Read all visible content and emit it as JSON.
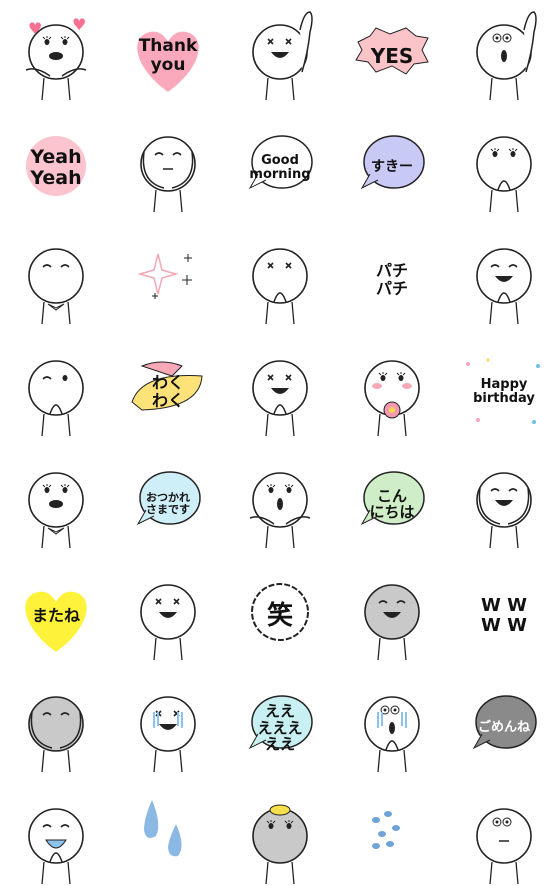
{
  "stickers": [
    {
      "kind": "face",
      "eyes": "lash",
      "mouth": "kiss",
      "extra": "hearts",
      "arms": "out"
    },
    {
      "kind": "bubble",
      "shape": "heart",
      "fill": "#f9a9bb",
      "text": "Thank\nyou",
      "size": 17
    },
    {
      "kind": "face",
      "eyes": "x",
      "mouth": "smile",
      "arms": "wave"
    },
    {
      "kind": "bubble",
      "shape": "burst",
      "fill": "#fbc4c9",
      "text": "YES",
      "size": 20
    },
    {
      "kind": "face",
      "eyes": "round",
      "mouth": "o",
      "arms": "wave"
    },
    {
      "kind": "bubble",
      "shape": "burst2",
      "fill": "#fbc4cf",
      "text": "Yeah\nYeah",
      "size": 19
    },
    {
      "kind": "face",
      "eyes": "closed",
      "mouth": "line",
      "arms": "cheeks"
    },
    {
      "kind": "bubble",
      "shape": "speech",
      "fill": "#ffffff",
      "text": "Good\nmorning",
      "size": 13
    },
    {
      "kind": "bubble",
      "shape": "speech",
      "fill": "#c9c9f5",
      "text": "すきー",
      "size": 14
    },
    {
      "kind": "face",
      "eyes": "lash",
      "mouth": "none",
      "arms": "mouth"
    },
    {
      "kind": "face",
      "eyes": "closed",
      "mouth": "none",
      "arms": "bow"
    },
    {
      "kind": "icon",
      "icon": "sparkles-icon",
      "accent": "#f3a6b3"
    },
    {
      "kind": "face",
      "eyes": "x",
      "mouth": "none",
      "arms": "clap"
    },
    {
      "kind": "bubble",
      "shape": "none",
      "fill": "#ffffff",
      "text": "パチ\nパチ",
      "size": 16
    },
    {
      "kind": "face",
      "eyes": "closed",
      "mouth": "smile",
      "arms": "clap2"
    },
    {
      "kind": "face",
      "eyes": "wink",
      "mouth": "none",
      "arms": "mouth"
    },
    {
      "kind": "bubble",
      "shape": "leaf",
      "fill": "#fde27a",
      "text": "わく\nわく",
      "size": 16
    },
    {
      "kind": "face",
      "eyes": "x",
      "mouth": "smile",
      "arms": "hold"
    },
    {
      "kind": "face",
      "eyes": "lash",
      "mouth": "none",
      "extra": "flower",
      "blush": true,
      "arms": "hold"
    },
    {
      "kind": "bubble",
      "shape": "confetti",
      "fill": "#ffffff",
      "text": "Happy\nbirthday",
      "size": 13
    },
    {
      "kind": "face",
      "eyes": "lash",
      "mouth": "kiss",
      "arms": "bow"
    },
    {
      "kind": "bubble",
      "shape": "speech",
      "fill": "#cfeff8",
      "text": "おつかれ\nさまです",
      "size": 11
    },
    {
      "kind": "face",
      "eyes": "lash",
      "mouth": "o",
      "arms": "out"
    },
    {
      "kind": "bubble",
      "shape": "speech",
      "fill": "#cfeec8",
      "text": "こん\nにちは",
      "size": 15
    },
    {
      "kind": "face",
      "eyes": "closed",
      "mouth": "smile",
      "arms": "cheeks"
    },
    {
      "kind": "bubble",
      "shape": "heart",
      "fill": "#fff23a",
      "text": "またね",
      "size": 16
    },
    {
      "kind": "face",
      "eyes": "x",
      "mouth": "smile",
      "arms": "none"
    },
    {
      "kind": "bubble",
      "shape": "cloud",
      "fill": "#ffffff",
      "text": "笑",
      "size": 26
    },
    {
      "kind": "face",
      "eyes": "closed",
      "mouth": "smile",
      "gray": true,
      "arms": "none"
    },
    {
      "kind": "bubble",
      "shape": "none",
      "fill": "#ffffff",
      "text": "W W\nW W",
      "size": 18
    },
    {
      "kind": "face",
      "eyes": "closed",
      "mouth": "none",
      "gray": true,
      "arms": "cheeks"
    },
    {
      "kind": "face",
      "eyes": "x",
      "mouth": "smile",
      "tears": true,
      "arms": "none"
    },
    {
      "kind": "bubble",
      "shape": "speech",
      "fill": "#c8f0f2",
      "text": "ええ\nえええ\nええ",
      "size": 15
    },
    {
      "kind": "face",
      "eyes": "round",
      "mouth": "o",
      "tears": true,
      "arms": "mouth"
    },
    {
      "kind": "bubble",
      "shape": "speech",
      "fill": "#8a8a8a",
      "text": "ごめんね",
      "size": 13,
      "color": "#ffffff"
    },
    {
      "kind": "face",
      "eyes": "closed",
      "mouth": "cry",
      "arms": "mouth"
    },
    {
      "kind": "icon",
      "icon": "teardrops-icon",
      "accent": "#8cb9e3"
    },
    {
      "kind": "face",
      "eyes": "lash",
      "mouth": "none",
      "gray": true,
      "extra": "bun",
      "arms": "none"
    },
    {
      "kind": "icon",
      "icon": "raindrops-icon",
      "accent": "#6fa3d8"
    },
    {
      "kind": "face",
      "eyes": "round",
      "mouth": "line",
      "arms": "none"
    }
  ],
  "colors": {
    "stroke": "#222222",
    "gray": "#c9c9c9",
    "blue": "#8cc3ea"
  }
}
